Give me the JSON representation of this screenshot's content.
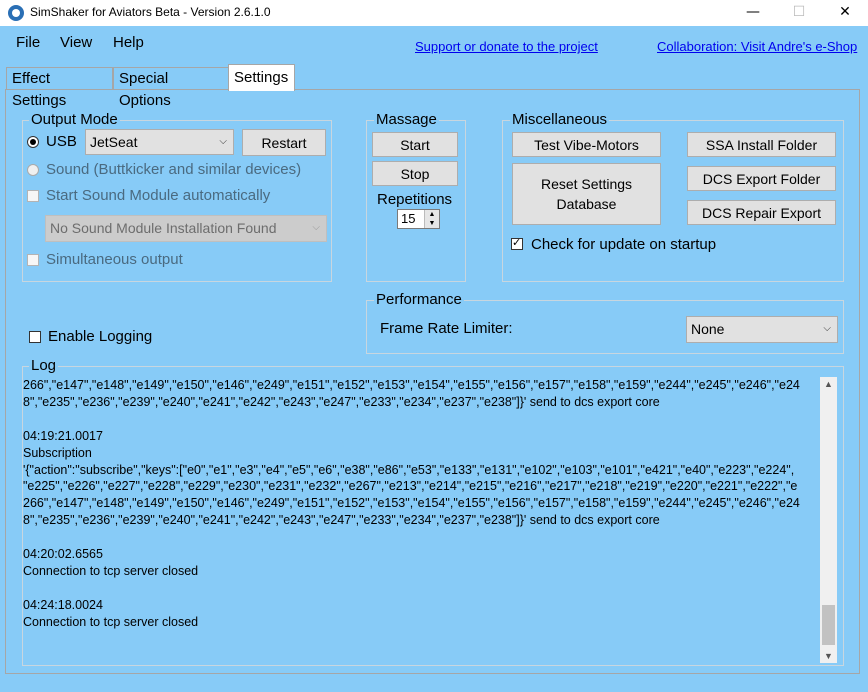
{
  "window": {
    "title": "SimShaker for Aviators Beta  - Version 2.6.1.0",
    "minimize": "—",
    "maximize": "☐",
    "close": "✕"
  },
  "menu": {
    "file": "File",
    "view": "View",
    "help": "Help",
    "support_link": "Support or donate to the project",
    "collab_link": "Collaboration: Visit Andre's e-Shop"
  },
  "tabs": [
    {
      "label": "Effect Settings"
    },
    {
      "label": "Special Options"
    },
    {
      "label": "Settings",
      "active": true
    }
  ],
  "output_mode": {
    "title": "Output Mode",
    "usb_label": "USB",
    "usb_device": "JetSeat",
    "restart": "Restart",
    "sound_label": "Sound (Buttkicker and similar devices)",
    "start_sound_label": "Start Sound Module automatically",
    "sound_module": "No Sound Module Installation Found",
    "simultaneous_label": "Simultaneous output"
  },
  "massage": {
    "title": "Massage",
    "start": "Start",
    "stop": "Stop",
    "repetitions_label": "Repetitions",
    "repetitions_value": "15"
  },
  "misc": {
    "title": "Miscellaneous",
    "test_vibe": "Test Vibe-Motors",
    "ssa_folder": "SSA Install Folder",
    "reset_line1": "Reset Settings",
    "reset_line2": "Database",
    "dcs_export": "DCS Export Folder",
    "dcs_repair": "DCS Repair Export",
    "check_update": "Check for update on startup"
  },
  "performance": {
    "title": "Performance",
    "frame_rate_label": "Frame Rate Limiter:",
    "frame_rate_value": "None"
  },
  "logging": {
    "enable_label": "Enable Logging"
  },
  "log": {
    "title": "Log",
    "lines": [
      "266\",\"e147\",\"e148\",\"e149\",\"e150\",\"e146\",\"e249\",\"e151\",\"e152\",\"e153\",\"e154\",\"e155\",\"e156\",\"e157\",\"e158\",\"e159\",\"e244\",\"e245\",\"e246\",\"e24",
      "8\",\"e235\",\"e236\",\"e239\",\"e240\",\"e241\",\"e242\",\"e243\",\"e247\",\"e233\",\"e234\",\"e237\",\"e238\"]}' send to dcs export core",
      "",
      "04:19:21.0017",
      "Subscription",
      "'{\"action\":\"subscribe\",\"keys\":[\"e0\",\"e1\",\"e3\",\"e4\",\"e5\",\"e6\",\"e38\",\"e86\",\"e53\",\"e133\",\"e131\",\"e102\",\"e103\",\"e101\",\"e421\",\"e40\",\"e223\",\"e224\",",
      "\"e225\",\"e226\",\"e227\",\"e228\",\"e229\",\"e230\",\"e231\",\"e232\",\"e267\",\"e213\",\"e214\",\"e215\",\"e216\",\"e217\",\"e218\",\"e219\",\"e220\",\"e221\",\"e222\",\"e",
      "266\",\"e147\",\"e148\",\"e149\",\"e150\",\"e146\",\"e249\",\"e151\",\"e152\",\"e153\",\"e154\",\"e155\",\"e156\",\"e157\",\"e158\",\"e159\",\"e244\",\"e245\",\"e246\",\"e24",
      "8\",\"e235\",\"e236\",\"e239\",\"e240\",\"e241\",\"e242\",\"e243\",\"e247\",\"e233\",\"e234\",\"e237\",\"e238\"]}' send to dcs export core",
      "",
      "04:20:02.6565",
      "Connection to tcp server closed",
      "",
      "04:24:18.0024",
      "Connection to tcp server closed"
    ]
  }
}
